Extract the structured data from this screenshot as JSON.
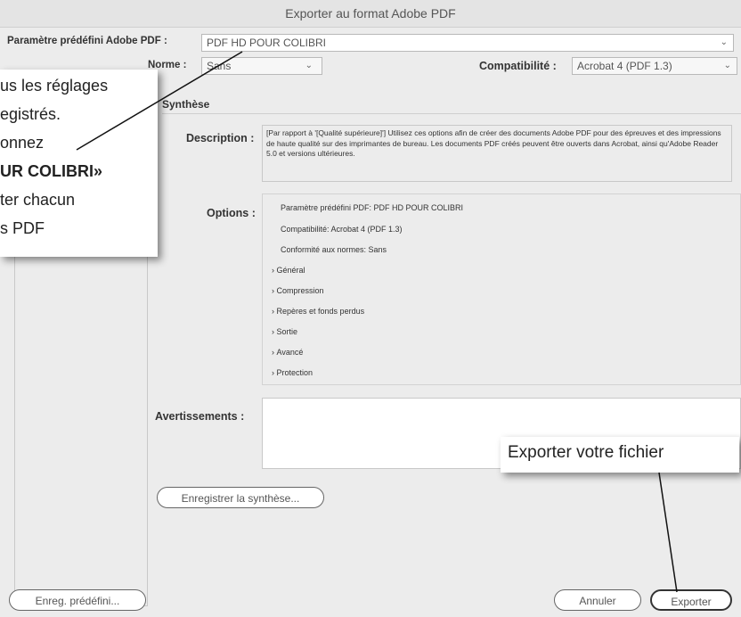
{
  "window": {
    "title": "Exporter au format Adobe PDF"
  },
  "preset": {
    "label": "Paramètre prédéfini Adobe PDF :",
    "value": "PDF HD POUR COLIBRI"
  },
  "standard": {
    "label": "Norme :",
    "value": "Sans"
  },
  "compat": {
    "label": "Compatibilité :",
    "value": "Acrobat 4 (PDF 1.3)"
  },
  "section": {
    "title": "Synthèse"
  },
  "description": {
    "label": "Description :",
    "text": "[Par rapport à '[Qualité supérieure]'] Utilisez ces options afin de créer des documents Adobe PDF pour des épreuves et des impressions de haute qualité sur des imprimantes de bureau. Les documents PDF créés peuvent être ouverts dans Acrobat, ainsi qu'Adobe Reader 5.0 et versions ultérieures."
  },
  "options": {
    "label": "Options :",
    "lines": [
      "Paramètre prédéfini PDF: PDF HD POUR COLIBRI",
      "Compatibilité: Acrobat 4 (PDF 1.3)",
      "Conformité aux normes: Sans"
    ],
    "groups": [
      "Général",
      "Compression",
      "Repères et fonds perdus",
      "Sortie",
      "Avancé",
      "Protection"
    ]
  },
  "warnings": {
    "label": "Avertissements :"
  },
  "buttons": {
    "save_summary": "Enregistrer la synthèse...",
    "save_preset": "Enreg. prédéfini...",
    "cancel": "Annuler",
    "export": "Exporter"
  },
  "annotations": {
    "left_lines": [
      "us les réglages",
      "egistrés.",
      "onnez",
      "UR COLIBRI»",
      "ter chacun",
      "s PDF"
    ],
    "right": "Exporter votre fichier"
  },
  "icons": {
    "chevron": "chevron-down-icon",
    "disclosure": "disclosure-triangle-icon"
  }
}
